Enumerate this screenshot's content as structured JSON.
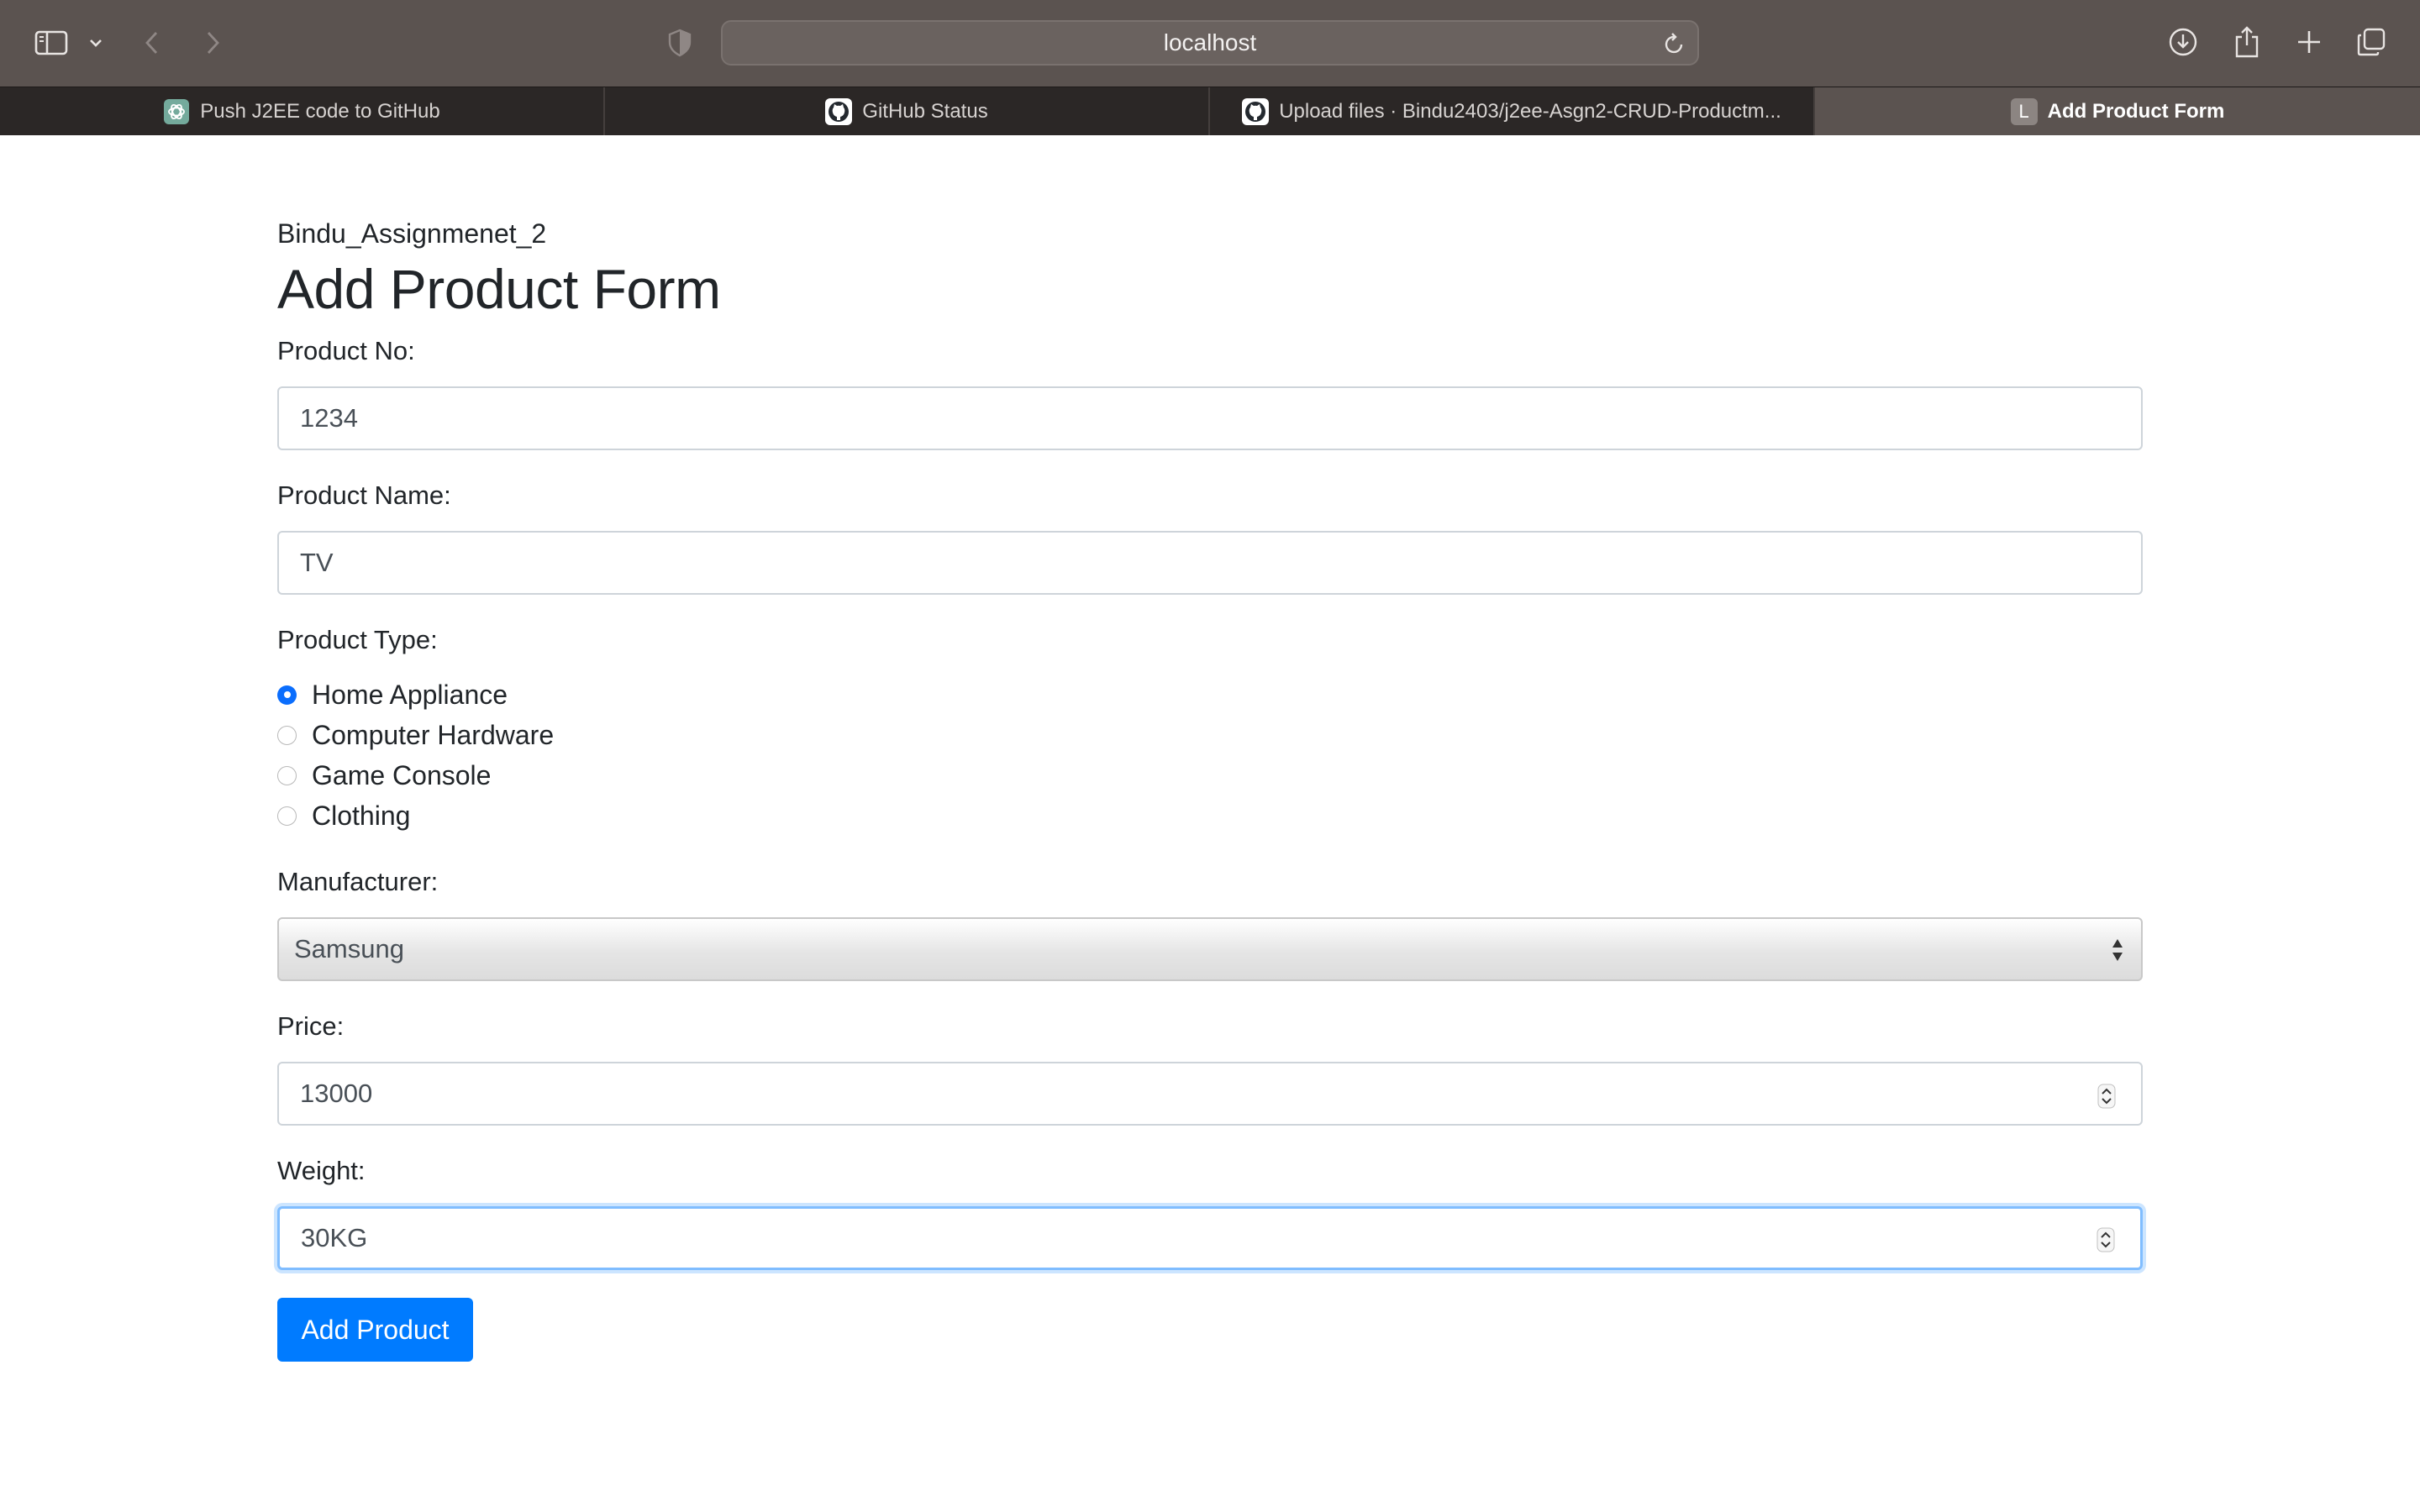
{
  "browser": {
    "url": "localhost",
    "tabs": [
      {
        "label": "Push J2EE code to GitHub",
        "icon": "openai-icon",
        "active": false
      },
      {
        "label": "GitHub Status",
        "icon": "github-icon",
        "active": false
      },
      {
        "label": "Upload files · Bindu2403/j2ee-Asgn2-CRUD-Productm...",
        "icon": "github-icon",
        "active": false
      },
      {
        "label": "Add Product Form",
        "icon": "letter-icon",
        "icon_letter": "L",
        "active": true
      }
    ]
  },
  "page": {
    "subtitle": "Bindu_Assignmenet_2",
    "title": "Add Product Form",
    "fields": {
      "product_no": {
        "label": "Product No:",
        "value": "1234"
      },
      "product_name": {
        "label": "Product Name:",
        "value": "TV"
      },
      "product_type": {
        "label": "Product Type:",
        "options": [
          "Home Appliance",
          "Computer Hardware",
          "Game Console",
          "Clothing"
        ],
        "selected": "Home Appliance"
      },
      "manufacturer": {
        "label": "Manufacturer:",
        "value": "Samsung"
      },
      "price": {
        "label": "Price:",
        "value": "13000"
      },
      "weight": {
        "label": "Weight:",
        "value": "30KG"
      }
    },
    "submit_label": "Add Product"
  },
  "colors": {
    "toolbar_bg": "#5b5350",
    "tabstrip_bg": "#2b2726",
    "primary": "#007bff",
    "radio_checked": "#0b6efd",
    "focus_border": "#80bdff"
  }
}
